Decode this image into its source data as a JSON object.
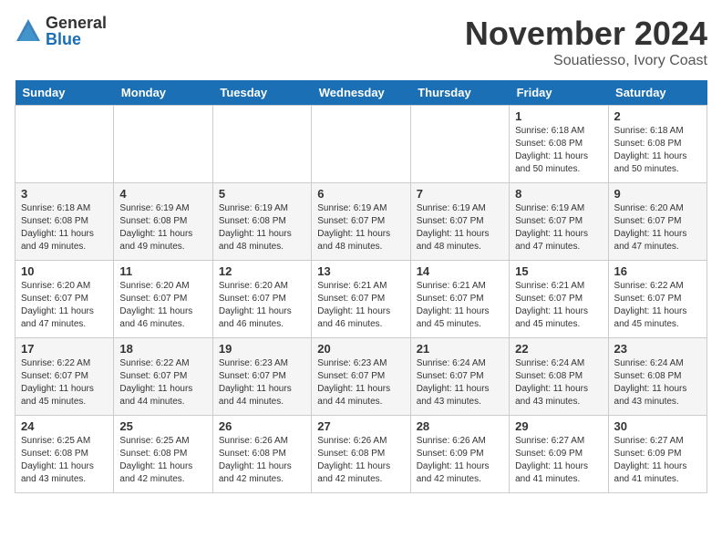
{
  "logo": {
    "general": "General",
    "blue": "Blue"
  },
  "title": "November 2024",
  "location": "Souatiesso, Ivory Coast",
  "headers": [
    "Sunday",
    "Monday",
    "Tuesday",
    "Wednesday",
    "Thursday",
    "Friday",
    "Saturday"
  ],
  "weeks": [
    [
      {
        "day": "",
        "info": ""
      },
      {
        "day": "",
        "info": ""
      },
      {
        "day": "",
        "info": ""
      },
      {
        "day": "",
        "info": ""
      },
      {
        "day": "",
        "info": ""
      },
      {
        "day": "1",
        "info": "Sunrise: 6:18 AM\nSunset: 6:08 PM\nDaylight: 11 hours\nand 50 minutes."
      },
      {
        "day": "2",
        "info": "Sunrise: 6:18 AM\nSunset: 6:08 PM\nDaylight: 11 hours\nand 50 minutes."
      }
    ],
    [
      {
        "day": "3",
        "info": "Sunrise: 6:18 AM\nSunset: 6:08 PM\nDaylight: 11 hours\nand 49 minutes."
      },
      {
        "day": "4",
        "info": "Sunrise: 6:19 AM\nSunset: 6:08 PM\nDaylight: 11 hours\nand 49 minutes."
      },
      {
        "day": "5",
        "info": "Sunrise: 6:19 AM\nSunset: 6:08 PM\nDaylight: 11 hours\nand 48 minutes."
      },
      {
        "day": "6",
        "info": "Sunrise: 6:19 AM\nSunset: 6:07 PM\nDaylight: 11 hours\nand 48 minutes."
      },
      {
        "day": "7",
        "info": "Sunrise: 6:19 AM\nSunset: 6:07 PM\nDaylight: 11 hours\nand 48 minutes."
      },
      {
        "day": "8",
        "info": "Sunrise: 6:19 AM\nSunset: 6:07 PM\nDaylight: 11 hours\nand 47 minutes."
      },
      {
        "day": "9",
        "info": "Sunrise: 6:20 AM\nSunset: 6:07 PM\nDaylight: 11 hours\nand 47 minutes."
      }
    ],
    [
      {
        "day": "10",
        "info": "Sunrise: 6:20 AM\nSunset: 6:07 PM\nDaylight: 11 hours\nand 47 minutes."
      },
      {
        "day": "11",
        "info": "Sunrise: 6:20 AM\nSunset: 6:07 PM\nDaylight: 11 hours\nand 46 minutes."
      },
      {
        "day": "12",
        "info": "Sunrise: 6:20 AM\nSunset: 6:07 PM\nDaylight: 11 hours\nand 46 minutes."
      },
      {
        "day": "13",
        "info": "Sunrise: 6:21 AM\nSunset: 6:07 PM\nDaylight: 11 hours\nand 46 minutes."
      },
      {
        "day": "14",
        "info": "Sunrise: 6:21 AM\nSunset: 6:07 PM\nDaylight: 11 hours\nand 45 minutes."
      },
      {
        "day": "15",
        "info": "Sunrise: 6:21 AM\nSunset: 6:07 PM\nDaylight: 11 hours\nand 45 minutes."
      },
      {
        "day": "16",
        "info": "Sunrise: 6:22 AM\nSunset: 6:07 PM\nDaylight: 11 hours\nand 45 minutes."
      }
    ],
    [
      {
        "day": "17",
        "info": "Sunrise: 6:22 AM\nSunset: 6:07 PM\nDaylight: 11 hours\nand 45 minutes."
      },
      {
        "day": "18",
        "info": "Sunrise: 6:22 AM\nSunset: 6:07 PM\nDaylight: 11 hours\nand 44 minutes."
      },
      {
        "day": "19",
        "info": "Sunrise: 6:23 AM\nSunset: 6:07 PM\nDaylight: 11 hours\nand 44 minutes."
      },
      {
        "day": "20",
        "info": "Sunrise: 6:23 AM\nSunset: 6:07 PM\nDaylight: 11 hours\nand 44 minutes."
      },
      {
        "day": "21",
        "info": "Sunrise: 6:24 AM\nSunset: 6:07 PM\nDaylight: 11 hours\nand 43 minutes."
      },
      {
        "day": "22",
        "info": "Sunrise: 6:24 AM\nSunset: 6:08 PM\nDaylight: 11 hours\nand 43 minutes."
      },
      {
        "day": "23",
        "info": "Sunrise: 6:24 AM\nSunset: 6:08 PM\nDaylight: 11 hours\nand 43 minutes."
      }
    ],
    [
      {
        "day": "24",
        "info": "Sunrise: 6:25 AM\nSunset: 6:08 PM\nDaylight: 11 hours\nand 43 minutes."
      },
      {
        "day": "25",
        "info": "Sunrise: 6:25 AM\nSunset: 6:08 PM\nDaylight: 11 hours\nand 42 minutes."
      },
      {
        "day": "26",
        "info": "Sunrise: 6:26 AM\nSunset: 6:08 PM\nDaylight: 11 hours\nand 42 minutes."
      },
      {
        "day": "27",
        "info": "Sunrise: 6:26 AM\nSunset: 6:08 PM\nDaylight: 11 hours\nand 42 minutes."
      },
      {
        "day": "28",
        "info": "Sunrise: 6:26 AM\nSunset: 6:09 PM\nDaylight: 11 hours\nand 42 minutes."
      },
      {
        "day": "29",
        "info": "Sunrise: 6:27 AM\nSunset: 6:09 PM\nDaylight: 11 hours\nand 41 minutes."
      },
      {
        "day": "30",
        "info": "Sunrise: 6:27 AM\nSunset: 6:09 PM\nDaylight: 11 hours\nand 41 minutes."
      }
    ]
  ]
}
